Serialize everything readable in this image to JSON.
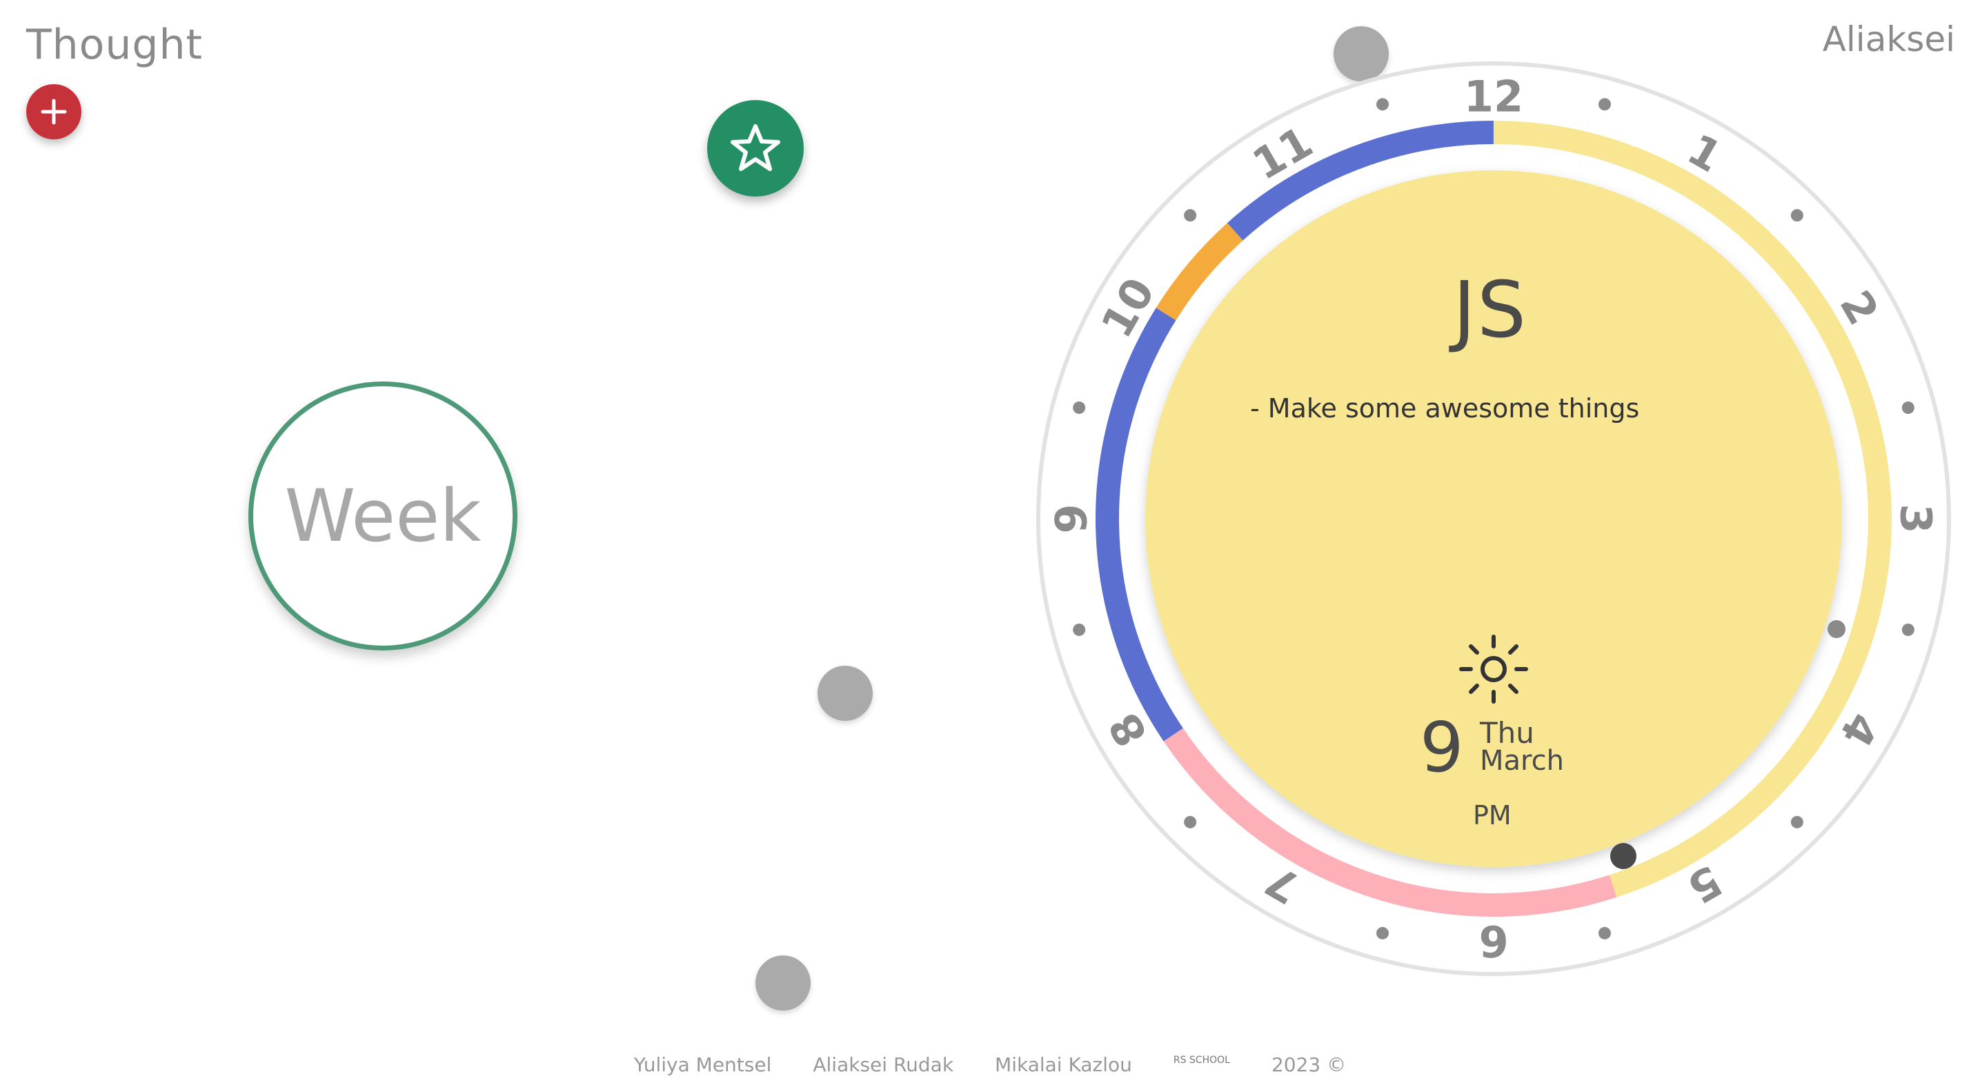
{
  "header": {
    "app_title": "Thought",
    "user_name": "Aliaksei"
  },
  "buttons": {
    "add_icon": "plus-icon",
    "favorites_icon": "star-icon"
  },
  "week_view": {
    "label": "Week"
  },
  "clock": {
    "hour_labels": [
      "12",
      "1",
      "2",
      "3",
      "4",
      "5",
      "6",
      "7",
      "8",
      "9",
      "10",
      "11"
    ],
    "task": {
      "title": "JS",
      "description": "- Make some awesome things"
    },
    "weather_icon": "sun-icon",
    "date": {
      "day": "9",
      "weekday": "Thu",
      "month": "March",
      "period": "PM"
    },
    "colors": {
      "face": "#f8e693",
      "blue_segment": "#5a6fd0",
      "orange_segment": "#f4ab3c",
      "pink_segment": "#fdb0b8",
      "yellow_segment": "#f8e693"
    }
  },
  "footer": {
    "authors": [
      "Yuliya Mentsel",
      "Aliaksei Rudak",
      "Mikalai Kazlou"
    ],
    "logo_text": "RS SCHOOL",
    "copyright": "2023 ©"
  },
  "colors": {
    "add_button": "#c6323a",
    "star_button": "#248f64",
    "week_border": "#4e9a78",
    "draggable_dot": "#aaaaaa"
  }
}
